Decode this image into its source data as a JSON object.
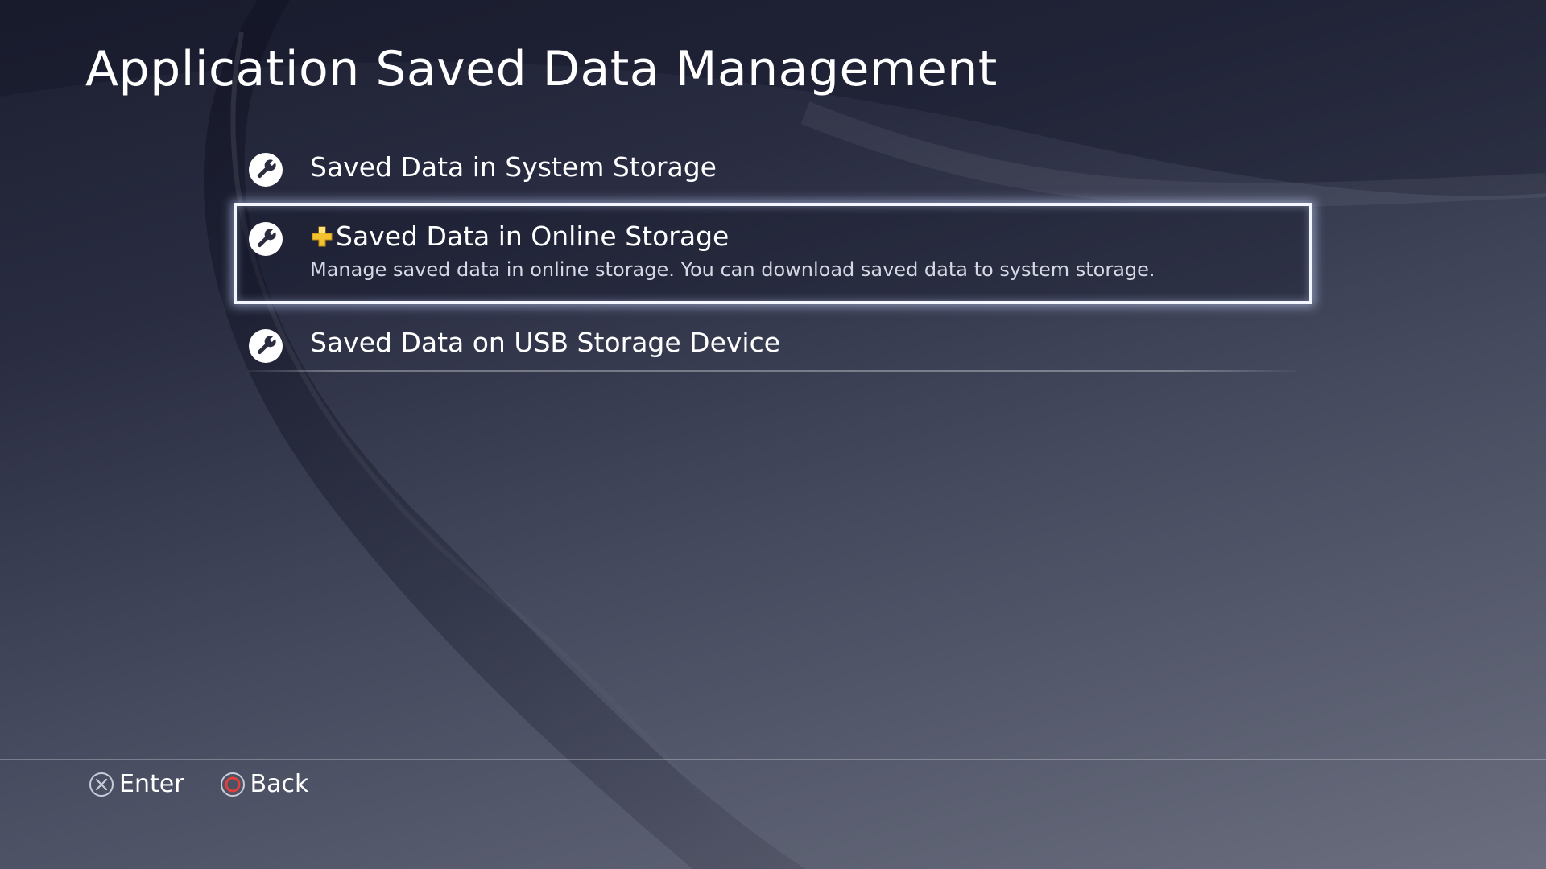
{
  "header": {
    "title": "Application Saved Data Management"
  },
  "menu": {
    "items": [
      {
        "label": "Saved Data in System Storage",
        "icon": "wrench-icon"
      },
      {
        "label": "Saved Data in Online Storage",
        "icon": "wrench-icon",
        "badge_icon": "playstation-plus-icon",
        "description": "Manage saved data in online storage. You can download saved data to system storage.",
        "selected": true
      },
      {
        "label": "Saved Data on USB Storage Device",
        "icon": "wrench-icon"
      }
    ]
  },
  "footer": {
    "enter": {
      "label": "Enter",
      "icon": "cross-button-icon"
    },
    "back": {
      "label": "Back",
      "icon": "circle-button-icon"
    }
  },
  "colors": {
    "plus_badge": "#f2c230",
    "circle_button": "#e0403a",
    "selection_border": "#f4f6ff"
  }
}
